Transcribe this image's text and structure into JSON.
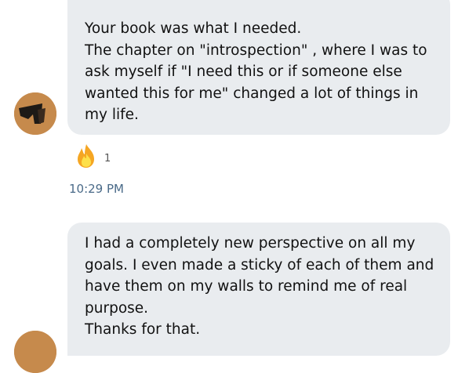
{
  "messages": [
    {
      "text": "Your book was what I needed.\nThe chapter on \"introspection\" , where I was to ask myself if \"I need this or if someone else wanted this for me\" changed a lot of things in my life.",
      "reaction": {
        "icon": "fire-emoji-icon",
        "count": "1"
      },
      "time": "10:29 PM"
    },
    {
      "text": "I had a completely new perspective on all my goals. I even made a sticky of each of them and have them on my walls to remind me of real purpose.\nThanks for that."
    }
  ],
  "colors": {
    "bubble_bg": "#e9ecef",
    "timestamp": "#4a6a88",
    "avatar": "#c68a4c"
  }
}
